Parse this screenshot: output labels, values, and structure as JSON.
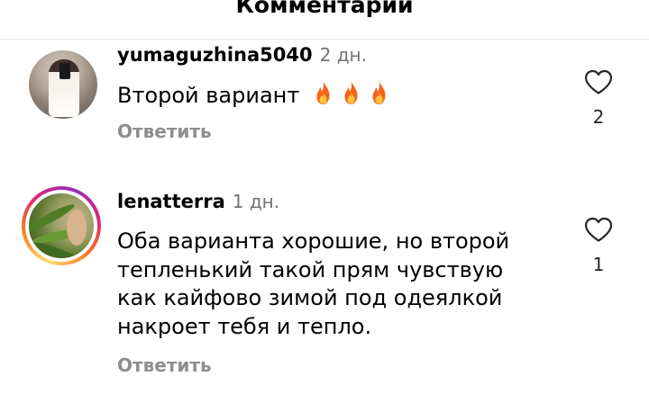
{
  "header": {
    "title": "Комментарии"
  },
  "comments": [
    {
      "username": "yumaguzhina5040",
      "time": "2 дн.",
      "text": "Второй вариант",
      "emoji": [
        "fire",
        "fire",
        "fire"
      ],
      "reply_label": "Ответить",
      "likes": "2"
    },
    {
      "username": "lenatterra",
      "time": "1 дн.",
      "text_lines": [
        "Оба варианта хорошие, но второй",
        "тепленький такой прям чувствую",
        "как кайфово зимой под одеялкой",
        "накроет тебя и тепло."
      ],
      "reply_label": "Ответить",
      "likes": "1",
      "has_story_ring": true
    }
  ],
  "colors": {
    "secondary_text": "#737373",
    "reply_text": "#8e8e8e",
    "divider": "#e3e3e3"
  },
  "icons": [
    "fire-icon",
    "heart-icon"
  ]
}
